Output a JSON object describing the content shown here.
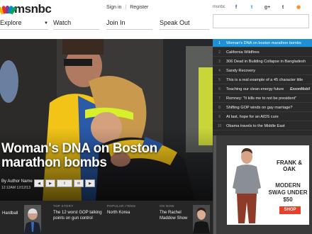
{
  "header": {
    "logo_text": "msnbc",
    "sign_in": "Sign in",
    "separator": "|",
    "register": "Register",
    "social_brand": "msnbc",
    "social_icons": [
      {
        "name": "facebook-icon",
        "glyph": "f",
        "color": "#3b5998"
      },
      {
        "name": "twitter-icon",
        "glyph": "t",
        "color": "#1da1f2"
      },
      {
        "name": "google-plus-icon",
        "glyph": "g+",
        "color": "#555555"
      },
      {
        "name": "tumblr-icon",
        "glyph": "t",
        "color": "#35465c"
      },
      {
        "name": "rss-icon",
        "glyph": "◉",
        "color": "#f08a1c"
      }
    ]
  },
  "nav": {
    "items": [
      "Explore",
      "Watch",
      "Join In",
      "Speak Out"
    ]
  },
  "search": {
    "placeholder": ""
  },
  "hero": {
    "headline": "Woman's DNA on Boston marathon bombs",
    "byline": "By Author Name",
    "timestamp": "12:12AM 12/12/13"
  },
  "bottom_strip": [
    {
      "category": "",
      "title": "Hardball",
      "has_thumb": true
    },
    {
      "category": "Top story",
      "title": "The 12 worst GOP talking points on gun control",
      "has_thumb": false
    },
    {
      "category": "Popular items",
      "title": "North Korea",
      "has_thumb": false
    },
    {
      "category": "On now",
      "title": "The Rachel Maddow Show",
      "has_thumb": true
    }
  ],
  "headline_list": [
    {
      "num": "1",
      "text": "Woman's DNA on boston marathon bombs",
      "active": true,
      "sponsor": ""
    },
    {
      "num": "2",
      "text": "California Wildfires",
      "active": false,
      "sponsor": ""
    },
    {
      "num": "3",
      "text": "306 Dead in Building Collapse in Bangladesh",
      "active": false,
      "sponsor": ""
    },
    {
      "num": "4",
      "text": "Sandy Recovery",
      "active": false,
      "sponsor": ""
    },
    {
      "num": "5",
      "text": "This is a real example of a 45 character title",
      "active": false,
      "sponsor": ""
    },
    {
      "num": "6",
      "text": "Teaching our clean energy future",
      "active": false,
      "sponsor": "ExxonMobil"
    },
    {
      "num": "7",
      "text": "Romney: \"It kills me to not be president\"",
      "active": false,
      "sponsor": ""
    },
    {
      "num": "8",
      "text": "Shifting GOP winds on gay marriage?",
      "active": false,
      "sponsor": ""
    },
    {
      "num": "9",
      "text": "At last, hope for an AIDS cure",
      "active": false,
      "sponsor": ""
    },
    {
      "num": "10",
      "text": "Obama travels to the Middle East",
      "active": false,
      "sponsor": ""
    }
  ],
  "ad": {
    "brand": "FRANK & OAK",
    "copy": "MODERN SWAG UNDER $50",
    "button": "SHOP"
  },
  "colors": {
    "accent_blue": "#1e90d6",
    "dark_panel": "#2a2a2a",
    "ad_button": "#e8402a"
  }
}
